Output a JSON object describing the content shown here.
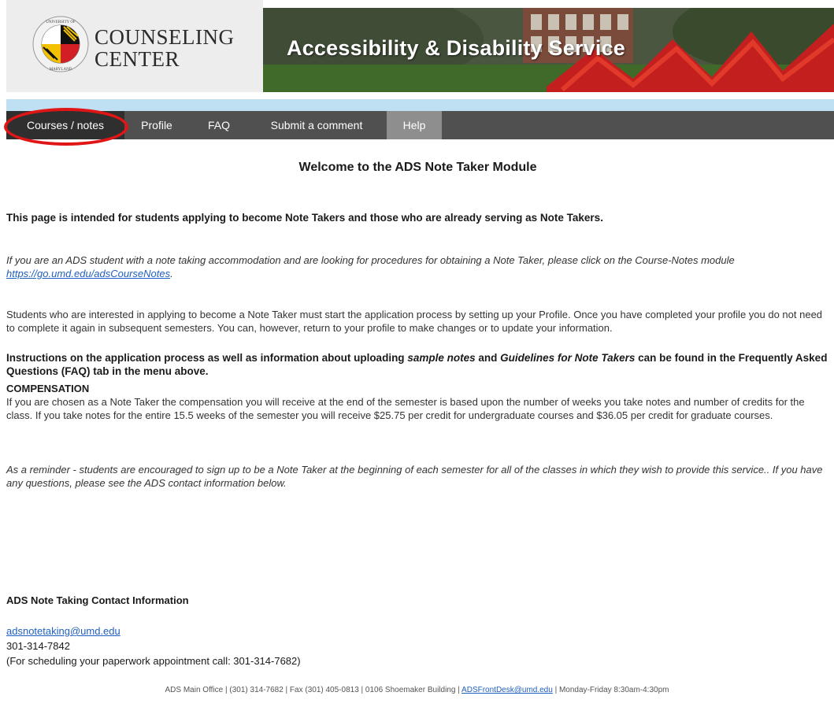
{
  "header": {
    "logo_line1": "COUNSELING",
    "logo_line2": "CENTER",
    "seal_text_top": "UNIVERSITY OF",
    "seal_text_bottom": "MARYLAND",
    "banner_title": "Accessibility & Disability Service"
  },
  "nav": {
    "tabs": [
      {
        "label": "Courses / notes"
      },
      {
        "label": "Profile"
      },
      {
        "label": "FAQ"
      },
      {
        "label": "Submit a comment"
      },
      {
        "label": "Help"
      }
    ]
  },
  "content": {
    "welcome": "Welcome to the ADS Note Taker Module",
    "intro": "This page is intended for students applying to become Note Takers and those who are already serving as Note Takers.",
    "ads_student_text": "If you are an ADS student with a note taking accommodation and are looking for procedures for obtaining a Note Taker,  please click on the Course-Notes module ",
    "ads_student_link": "https://go.umd.edu/adsCourseNotes",
    "ads_student_end": ".",
    "profile_paragraph": "Students who are interested in applying to become a Note Taker must start the application process by setting up your Profile. Once you have completed your profile you do not need to complete it again in subsequent semesters.  You can, however, return to your profile to make changes or to update your information.",
    "instructions_part1": "Instructions on the application process as well as information about uploading ",
    "instructions_em1": "sample notes",
    "instructions_part2": " and ",
    "instructions_em2": "Guidelines for Note Takers",
    "instructions_part3": " can be found in the Frequently Asked Questions (FAQ) tab in the menu above.",
    "compensation_heading": "COMPENSATION",
    "compensation_body": "If you are chosen as a Note Taker the compensation you will receive at the end of the semester is based upon the number of weeks you take notes and number of credits for the class. If you take notes for the entire 15.5 weeks of the semester you will receive $25.75 per credit for undergraduate courses and $36.05 per credit for graduate courses.",
    "reminder": "As a reminder - students are encouraged to sign up to be a Note Taker at the beginning of each semester for all of the classes in which they wish to provide this service..  If you have any questions, please see the ADS contact information below.",
    "contact_heading": "ADS Note Taking Contact Information",
    "contact_email": "adsnotetaking@umd.edu",
    "contact_phone": "301-314-7842",
    "contact_schedule": "(For scheduling your paperwork appointment call: 301-314-7682)"
  },
  "footer": {
    "before": "ADS Main Office | (301) 314-7682 | Fax (301) 405-0813 | 0106 Shoemaker Building | ",
    "email": "ADSFrontDesk@umd.edu",
    "after": " | Monday-Friday 8:30am-4:30pm"
  },
  "colors": {
    "nav_bg": "#505050",
    "nav_active": "#2f2f2f",
    "nav_help": "#8e8e8e",
    "highlight_ring": "#e01616",
    "link": "#1f5fbf",
    "nav_strip": "#bfe0f2"
  }
}
